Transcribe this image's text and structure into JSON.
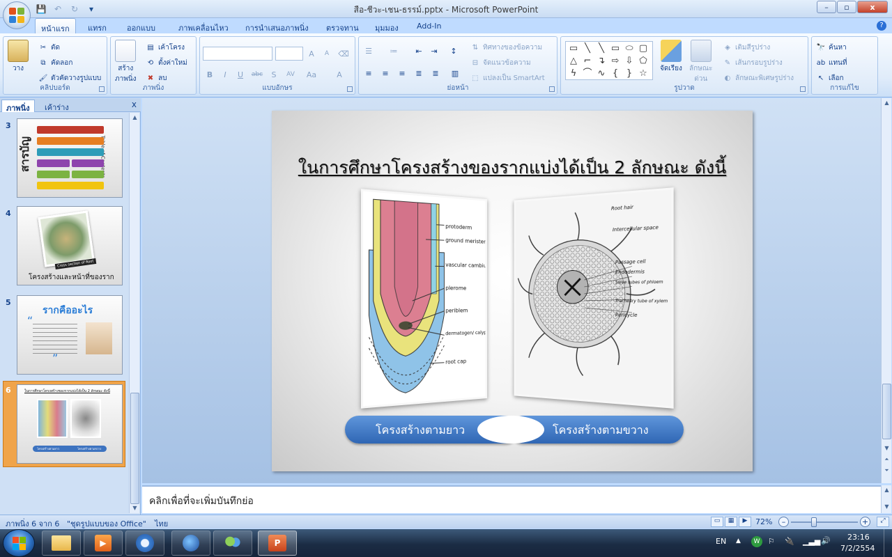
{
  "window": {
    "title": "สือ-ชีวะ-เชน-ธรรม์.pptx - Microsoft PowerPoint",
    "min": "–",
    "max": "▫",
    "close": "x"
  },
  "qat": {
    "save": "💾",
    "undo": "↶",
    "redo": "↻",
    "more": "▾"
  },
  "tabs": [
    "หน้าแรก",
    "แทรก",
    "ออกแบบ",
    "ภาพเคลื่อนไหว",
    "การนำเสนอภาพนิ่ง",
    "ตรวจทาน",
    "มุมมอง",
    "Add-In"
  ],
  "help": "?",
  "ribbon": {
    "clipboard": {
      "label": "คลิปบอร์ด",
      "paste": "วาง",
      "cut": "ตัด",
      "copy": "คัดลอก",
      "format_painter": "ตัวคัดวางรูปแบบ"
    },
    "slides": {
      "label": "ภาพนิ่ง",
      "new_slide_line1": "สร้าง",
      "new_slide_line2": "ภาพนิ่ง",
      "layout": "เค้าโครง",
      "reset": "ตั้งค่าใหม่",
      "delete": "ลบ"
    },
    "font": {
      "label": "แบบอักษร",
      "bold": "B",
      "italic": "I",
      "underline": "U",
      "strike": "abc",
      "shadow": "S",
      "spacing": "AV",
      "case": "Aa",
      "color": "A",
      "grow": "A",
      "shrink": "A"
    },
    "paragraph": {
      "label": "ย่อหน้า",
      "text_direction": "ทิศทางของข้อความ",
      "align_text": "จัดแนวข้อความ",
      "smartart": "แปลงเป็น SmartArt"
    },
    "drawing": {
      "label": "รูปวาด",
      "arrange": "จัดเรียง",
      "quick_styles_line1": "ลักษณะ",
      "quick_styles_line2": "ด่วน",
      "fill": "เติมสีรูปร่าง",
      "outline": "เส้นกรอบรูปร่าง",
      "effects": "ลักษณะพิเศษรูปร่าง"
    },
    "editing": {
      "label": "การแก้ไข",
      "find": "ค้นหา",
      "replace": "แทนที่",
      "select": "เลือก"
    }
  },
  "panel": {
    "tab_slides": "ภาพนิ่ง",
    "tab_outline": "เค้าร่าง",
    "close": "x",
    "slides": [
      {
        "num": "3",
        "title": "สารบัญ",
        "side": "Table of Contents"
      },
      {
        "num": "4",
        "caption": "โครงสร้างและหน้าที่ของราก",
        "banner": "Cross section of Root"
      },
      {
        "num": "5",
        "title": "รากคืออะไร"
      },
      {
        "num": "6",
        "title": "ในการศึกษาโครงสร้างของรากแบ่งได้เป็น 2 ลักษณะ ดังนี้",
        "left": "โครงสร้างตามยาว",
        "right": "โครงสร้างตามขวาง"
      }
    ]
  },
  "slide": {
    "title": "ในการศึกษาโครงสร้างของรากแบ่งได้เป็น 2 ลักษณะ ดังนี้",
    "left_label": "โครงสร้างตามยาว",
    "right_label": "โครงสร้างตามขวาง",
    "longitudinal_labels": [
      "protoderm",
      "ground meristem",
      "vascular cambium",
      "plerome",
      "periblem",
      "dermatogen/ calyptrogen complex",
      "root cap"
    ],
    "cross_labels": [
      "Root hair",
      "Intercellular space",
      "Passage cell",
      "Endodermis",
      "Sieve tubes of phloem",
      "Tracheary tube of xylem",
      "Pericycle"
    ]
  },
  "notes": {
    "placeholder": "คลิกเพื่อที่จะเพิ่มบันทึกย่อ"
  },
  "status": {
    "slide_of": "ภาพนิ่ง 6 จาก 6",
    "theme": "\"ชุดรูปแบบของ Office\"",
    "language": "ไทย",
    "zoom": "72%",
    "zoom_out": "–",
    "zoom_in": "+"
  },
  "taskbar": {
    "lang": "EN",
    "time": "23:16",
    "date": "7/2/2554"
  }
}
